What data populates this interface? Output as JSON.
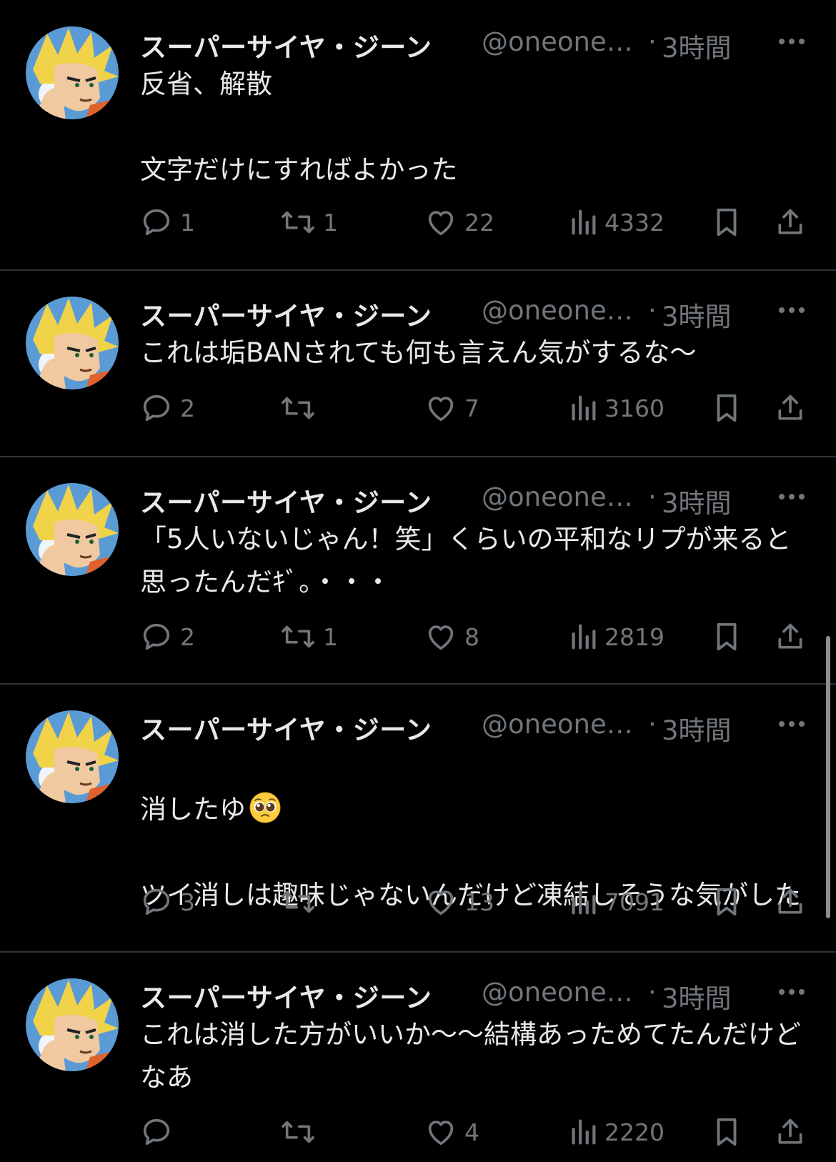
{
  "colors": {
    "background": "#000000",
    "text": "#e7e9ea",
    "secondary": "#71767b",
    "divider": "#2f3336"
  },
  "tweets": [
    {
      "display_name": "スーパーサイヤ・ジーン",
      "handle": "@oneone…",
      "separator": "·",
      "time": "3時間",
      "text": "反省、解散\n\n文字だけにすればよかった",
      "replies": "1",
      "retweets": "1",
      "likes": "22",
      "views": "4332"
    },
    {
      "display_name": "スーパーサイヤ・ジーン",
      "handle": "@oneone…",
      "separator": "·",
      "time": "3時間",
      "text": "これは垢BANされても何も言えん気がするな〜",
      "replies": "2",
      "retweets": "",
      "likes": "7",
      "views": "3160"
    },
    {
      "display_name": "スーパーサイヤ・ジーン",
      "handle": "@oneone…",
      "separator": "·",
      "time": "3時間",
      "text": "「5人いないじゃん！笑」くらいの平和なリプが来ると思ったんだｷﾞ。・・・",
      "replies": "2",
      "retweets": "1",
      "likes": "8",
      "views": "2819"
    },
    {
      "display_name": "スーパーサイヤ・ジーン",
      "handle": "@oneone…",
      "separator": "·",
      "time": "3時間",
      "text_line1": "消したゆ",
      "emoji": "pleading-face-emoji",
      "text_rest": "ツイ消しは趣味じゃないんだけど凍結しそうな気がした",
      "replies": "3",
      "retweets": "",
      "likes": "13",
      "views": "7091"
    },
    {
      "display_name": "スーパーサイヤ・ジーン",
      "handle": "@oneone…",
      "separator": "·",
      "time": "3時間",
      "text": "これは消した方がいいか〜〜結構あっためてたんだけどなあ",
      "replies": "",
      "retweets": "",
      "likes": "4",
      "views": "2220"
    }
  ],
  "icons": {
    "avatar": "avatar-image",
    "more": "more-icon",
    "reply": "reply-icon",
    "retweet": "retweet-icon",
    "like": "heart-icon",
    "views": "views-icon",
    "bookmark": "bookmark-icon",
    "share": "share-icon"
  }
}
